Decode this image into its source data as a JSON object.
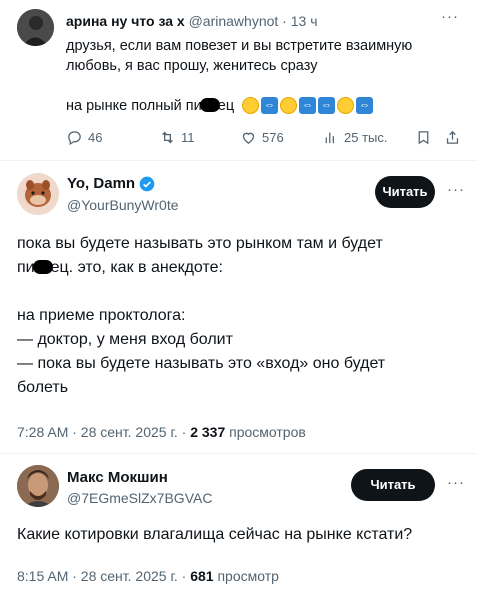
{
  "tweets": [
    {
      "name": "арина ну что за х",
      "handle": "@arinawhynot",
      "time_sep": "·",
      "time": "13 ч",
      "more": "···",
      "body_line1": "друзья, если вам повезет и вы встретите взаимную",
      "body_line2": "любовь, я вас прошу, женитесь сразу",
      "body_line3a": "на рынке полный пи",
      "body_line3b": "ец",
      "emojis": [
        "smiling-face",
        "left-right-arrow",
        "smiling-face",
        "left-right-arrow",
        "left-right-arrow",
        "smiling-face",
        "left-right-arrow"
      ],
      "replies": "46",
      "reposts": "11",
      "likes": "576",
      "views": "25 тыс."
    },
    {
      "name": "Yo, Damn",
      "handle": "@YourBunyWr0te",
      "read_label": "Читать",
      "more": "···",
      "body_line1a": "пока вы будете называть это рынком там и будет",
      "body_line2a": "пи",
      "body_line2b": "ец. это, как в анекдоте:",
      "body_line3": "на приеме проктолога:",
      "body_line4": "— доктор, у меня вход болит",
      "body_line5": "— пока вы будете называть это «вход» оно будет",
      "body_line6": "болеть",
      "meta_time": "7:28 AM · 28 сент. 2025 г. · ",
      "meta_views": "2 337",
      "meta_views_label": " просмотров"
    },
    {
      "name": "Макс Мокшин",
      "handle": "@7EGmeSlZx7BGVAC",
      "read_label": "Читать",
      "more": "···",
      "body": "Какие котировки влагалища сейчас на рынке кстати?",
      "meta_time": "8:15 AM · 28 сент. 2025 г. · ",
      "meta_views": "681",
      "meta_views_label": " просмотр"
    }
  ],
  "colors": {
    "text": "#0f1419",
    "muted": "#536471",
    "verified": "#1d9bf0",
    "button": "#0f1419"
  }
}
